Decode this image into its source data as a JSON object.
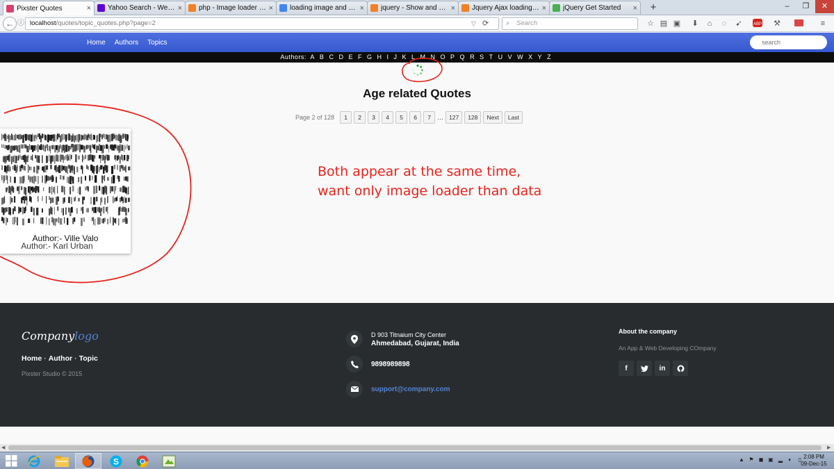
{
  "browser": {
    "tabs": [
      {
        "title": "Pixster Quotes",
        "favicon": "pixster-icon",
        "color": "#d9416d",
        "active": true
      },
      {
        "title": "Yahoo Search - Web Search",
        "favicon": "yahoo-icon",
        "color": "#5f01d1"
      },
      {
        "title": "php - Image loader in pag...",
        "favicon": "stackoverflow-icon",
        "color": "#f48024"
      },
      {
        "title": "loading image and data a...",
        "favicon": "google-icon",
        "color": "#4285f4"
      },
      {
        "title": "jquery - Show and hide lo...",
        "favicon": "stackoverflow-icon",
        "color": "#f48024"
      },
      {
        "title": "Jquery Ajax loading image...",
        "favicon": "stackoverflow-icon",
        "color": "#f48024"
      },
      {
        "title": "jQuery Get Started",
        "favicon": "w3schools-icon",
        "color": "#4caf50"
      }
    ],
    "url_host": "localhost",
    "url_path": "/quotes/topic_quotes.php?page=2",
    "search_placeholder": "Search"
  },
  "site": {
    "nav": [
      "Home",
      "Authors",
      "Topics"
    ],
    "search_placeholder": "search",
    "alpha_label": "Authors:",
    "letters": [
      "A",
      "B",
      "C",
      "D",
      "E",
      "F",
      "G",
      "H",
      "I",
      "J",
      "K",
      "L",
      "M",
      "N",
      "O",
      "P",
      "Q",
      "R",
      "S",
      "T",
      "U",
      "V",
      "W",
      "X",
      "Y",
      "Z"
    ],
    "page_title": "Age related Quotes",
    "pagination": {
      "info": "Page 2 of 128",
      "pages": [
        "1",
        "2",
        "3",
        "4",
        "5",
        "6",
        "7"
      ],
      "ellipsis": "…",
      "tail": [
        "127",
        "128"
      ],
      "next": "Next",
      "last": "Last"
    },
    "quote_card": {
      "author_lines": [
        "Author:- Ville Valo",
        "Author:- Karl Urban"
      ]
    }
  },
  "annotation": {
    "line1": "Both appear at the same time,",
    "line2": "want only image loader than data"
  },
  "footer": {
    "logo_main": "Company",
    "logo_accent": "logo",
    "links": [
      "Home",
      "Author",
      "Topic"
    ],
    "copyright": "Pixster Studio © 2015",
    "address_line1": "D 903 Titnaium City Center",
    "address_line2": "Ahmedabad, Gujarat, India",
    "phone": "9898989898",
    "email": "support@company.com",
    "about_heading": "About the company",
    "about_text": "An App & Web Developing COmpany",
    "social": [
      "facebook-icon",
      "twitter-icon",
      "linkedin-icon",
      "github-icon"
    ]
  },
  "taskbar": {
    "clock_time": "2:08 PM",
    "clock_date": "09-Dec-15"
  }
}
